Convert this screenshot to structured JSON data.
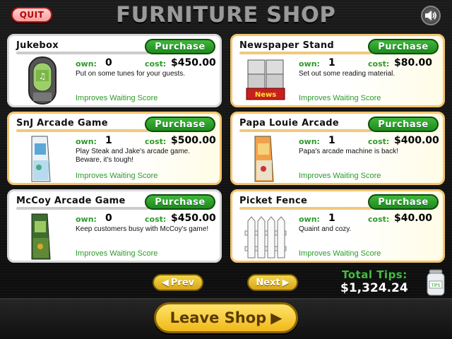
{
  "header": {
    "quit_label": "QUIT",
    "title": "FURNITURE SHOP",
    "sound_icon": "speaker-icon"
  },
  "items": [
    {
      "name": "Jukebox",
      "own_label": "own:",
      "own": "0",
      "cost_label": "cost:",
      "cost": "$450.00",
      "description": "Put on some tunes for your guests.",
      "improves": "Improves Waiting Score",
      "button": "Purchase",
      "icon": "jukebox-icon"
    },
    {
      "name": "Newspaper Stand",
      "own_label": "own:",
      "own": "1",
      "cost_label": "cost:",
      "cost": "$80.00",
      "description": "Set out some reading material.",
      "improves": "Improves Waiting Score",
      "button": "Purchase",
      "icon": "newspaper-stand-icon",
      "stand_label": "News"
    },
    {
      "name": "SnJ Arcade Game",
      "own_label": "own:",
      "own": "1",
      "cost_label": "cost:",
      "cost": "$500.00",
      "description": "Play Steak and Jake's arcade game. Beware, it's tough!",
      "improves": "Improves Waiting Score",
      "button": "Purchase",
      "icon": "arcade-cabinet-icon"
    },
    {
      "name": "Papa Louie Arcade",
      "own_label": "own:",
      "own": "1",
      "cost_label": "cost:",
      "cost": "$400.00",
      "description": "Papa's arcade machine is back!",
      "improves": "Improves Waiting Score",
      "button": "Purchase",
      "icon": "arcade-cabinet-icon"
    },
    {
      "name": "McCoy Arcade Game",
      "own_label": "own:",
      "own": "0",
      "cost_label": "cost:",
      "cost": "$450.00",
      "description": "Keep customers busy with McCoy's game!",
      "improves": "Improves Waiting Score",
      "button": "Purchase",
      "icon": "arcade-cabinet-icon"
    },
    {
      "name": "Picket Fence",
      "own_label": "own:",
      "own": "1",
      "cost_label": "cost:",
      "cost": "$40.00",
      "description": "Quaint and cozy.",
      "improves": "Improves Waiting Score",
      "button": "Purchase",
      "icon": "picket-fence-icon"
    }
  ],
  "nav": {
    "prev_label": "Prev",
    "next_label": "Next"
  },
  "tips": {
    "label": "Total Tips:",
    "value": "$1,324.24",
    "jar_label": "TIPS"
  },
  "leave_label": "Leave Shop",
  "colors": {
    "purchase_green": "#1f8a1c",
    "owned_border": "#f3c56e",
    "nav_yellow": "#f0b81a",
    "tips_green": "#40c040"
  }
}
